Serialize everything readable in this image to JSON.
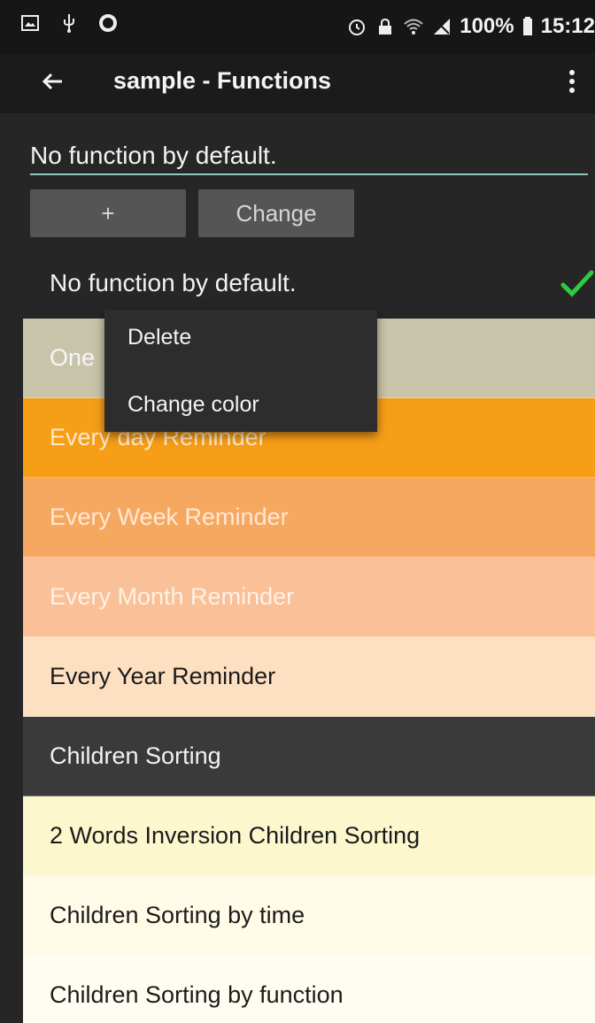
{
  "status_bar": {
    "battery": "100%",
    "time": "15:12",
    "icons": [
      "image-icon",
      "usb-icon",
      "circle-notification-icon",
      "alarm-icon",
      "lock-icon",
      "wifi-icon",
      "signal-off-icon",
      "battery-icon"
    ]
  },
  "app_bar": {
    "title": "sample - Functions",
    "back_icon": "arrow-left-icon",
    "overflow_icon": "more-vertical-icon"
  },
  "editor": {
    "value": "No function by default."
  },
  "buttons": {
    "add_label": "+",
    "change_label": "Change"
  },
  "default_row": {
    "label": "No function by default.",
    "check_icon": "check-icon",
    "check_color": "#2ecc40"
  },
  "list": {
    "items": [
      {
        "label": "One",
        "bg": "#c8c4a9",
        "fg": "#f6f6f6"
      },
      {
        "label": "Every day Reminder",
        "bg": "#f79e17",
        "fg": "#ffe8c9"
      },
      {
        "label": "Every Week Reminder",
        "bg": "#f7a860",
        "fg": "#ffe8d6"
      },
      {
        "label": "Every Month Reminder",
        "bg": "#fac097",
        "fg": "#fff1e6"
      },
      {
        "label": "Every Year Reminder",
        "bg": "#fde0c2",
        "fg": "#1b1b1b"
      },
      {
        "label": "Children Sorting",
        "bg": "#3a3a3a",
        "fg": "#f2f2f2"
      },
      {
        "label": "2 Words Inversion Children Sorting",
        "bg": "#fdf7cd",
        "fg": "#1b1b1b"
      },
      {
        "label": "Children Sorting by time",
        "bg": "#fffbe7",
        "fg": "#1b1b1b"
      },
      {
        "label": "Children Sorting by function",
        "bg": "#fffdf2",
        "fg": "#1b1b1b"
      }
    ]
  },
  "popup": {
    "items": [
      {
        "label": "Delete"
      },
      {
        "label": "Change color"
      }
    ]
  }
}
